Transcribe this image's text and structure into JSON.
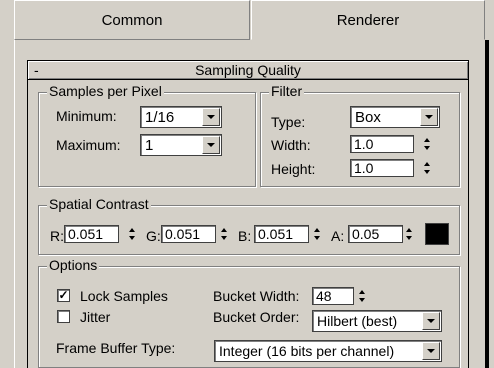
{
  "tabs": [
    {
      "label": "Common"
    },
    {
      "label": "Renderer"
    }
  ],
  "rollout": {
    "toggle": "-",
    "title": "Sampling Quality"
  },
  "samples_per_pixel": {
    "title": "Samples per Pixel",
    "minimum_label": "Minimum:",
    "minimum_value": "1/16",
    "maximum_label": "Maximum:",
    "maximum_value": "1"
  },
  "filter": {
    "title": "Filter",
    "type_label": "Type:",
    "type_value": "Box",
    "width_label": "Width:",
    "width_value": "1.0",
    "height_label": "Height:",
    "height_value": "1.0"
  },
  "spatial_contrast": {
    "title": "Spatial Contrast",
    "r_label": "R:",
    "r_value": "0.051",
    "g_label": "G:",
    "g_value": "0.051",
    "b_label": "B:",
    "b_value": "0.051",
    "a_label": "A:",
    "a_value": "0.05",
    "swatch_color": "#000000"
  },
  "options": {
    "title": "Options",
    "lock_samples_label": "Lock Samples",
    "lock_samples_checked": true,
    "jitter_label": "Jitter",
    "jitter_checked": false,
    "bucket_width_label": "Bucket Width:",
    "bucket_width_value": "48",
    "bucket_order_label": "Bucket Order:",
    "bucket_order_value": "Hilbert (best)",
    "frame_buffer_label": "Frame Buffer Type:",
    "frame_buffer_value": "Integer (16 bits per channel)"
  },
  "icons": {
    "checkmark": "✓",
    "spinner": "spinner-arrows-icon",
    "dropdown": "chevron-down-icon"
  }
}
